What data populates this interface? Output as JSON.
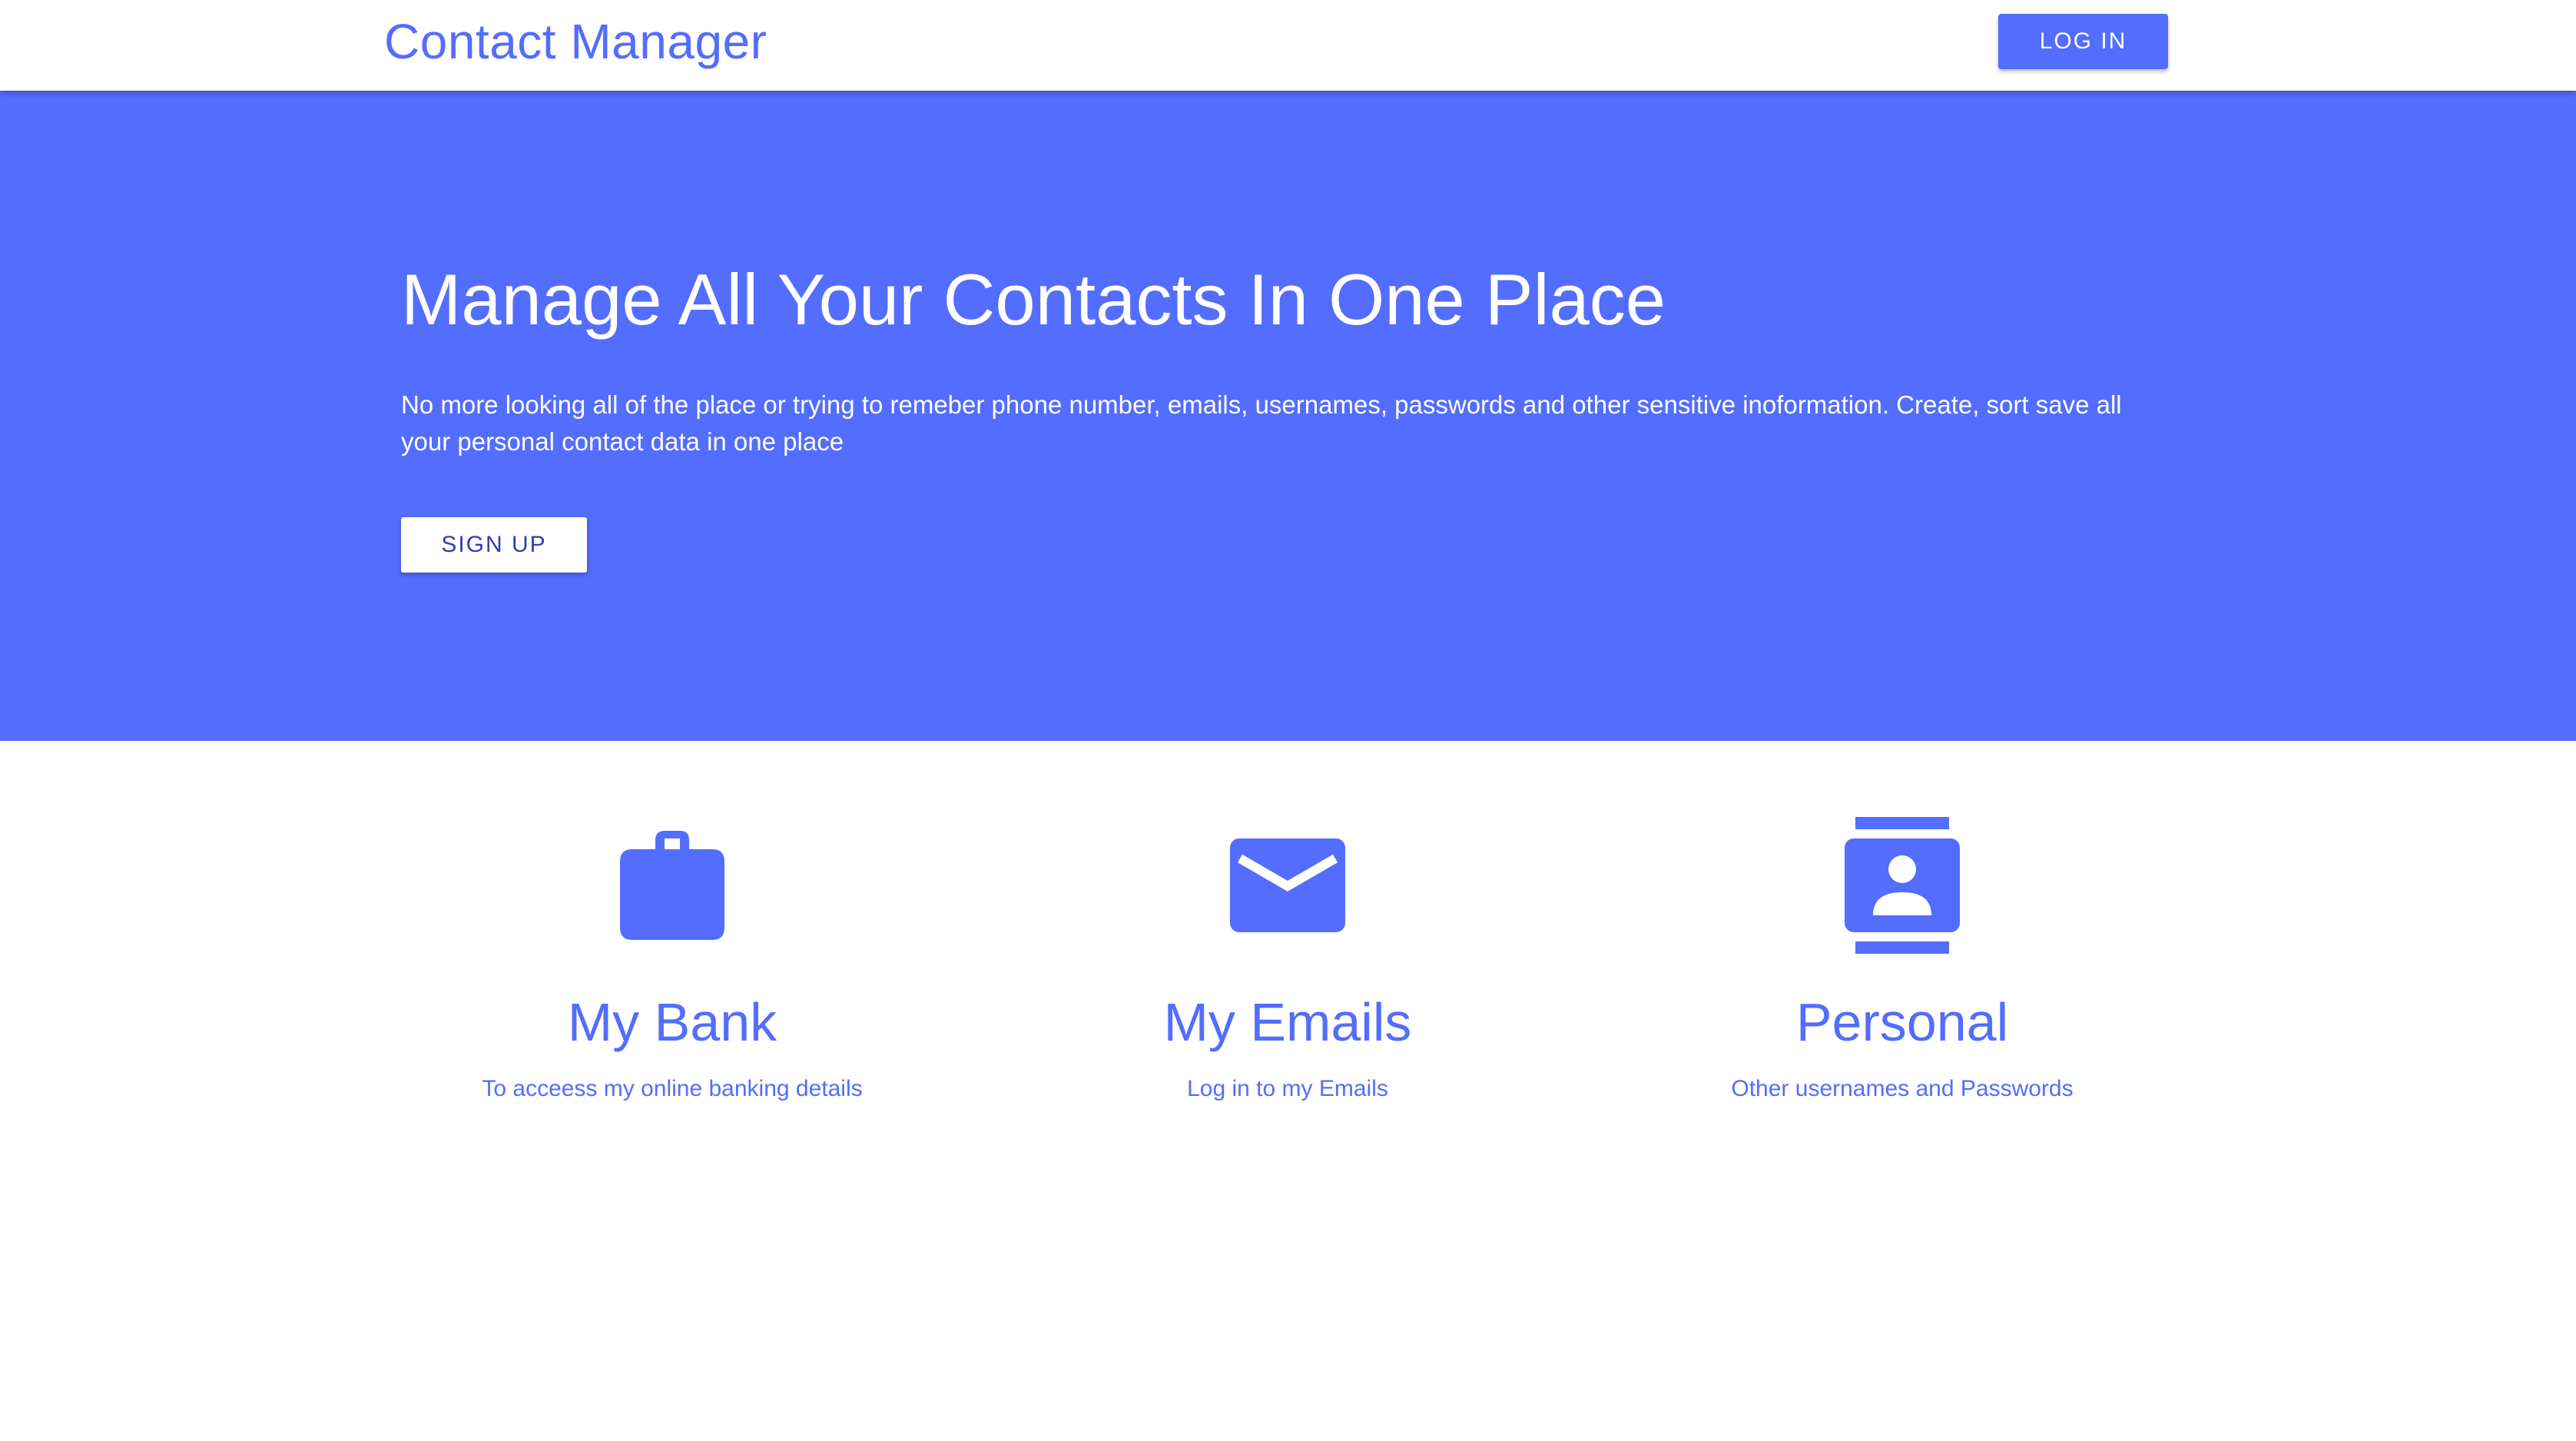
{
  "header": {
    "brand": "Contact Manager",
    "login_label": "LOG IN"
  },
  "hero": {
    "title": "Manage All Your Contacts In One Place",
    "text": "No more looking all of the place or trying to remeber phone number, emails, usernames, passwords and other sensitive inoformation. Create, sort save all your personal contact data in one place",
    "signup_label": "SIGN UP"
  },
  "features": [
    {
      "icon": "briefcase-icon",
      "title": "My Bank",
      "text": "To acceess my online banking details"
    },
    {
      "icon": "envelope-icon",
      "title": "My Emails",
      "text": "Log in to my Emails"
    },
    {
      "icon": "contacts-icon",
      "title": "Personal",
      "text": "Other usernames and Passwords"
    }
  ],
  "colors": {
    "primary": "#536dfe",
    "background": "#ffffff",
    "signup_text": "#2f3fb0"
  }
}
